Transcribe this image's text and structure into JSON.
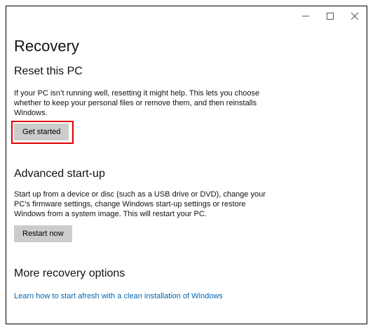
{
  "window": {
    "controls": [
      {
        "name": "minimize",
        "icon": "minimize-icon"
      },
      {
        "name": "maximize",
        "icon": "maximize-icon"
      },
      {
        "name": "close",
        "icon": "close-icon"
      }
    ]
  },
  "page": {
    "title": "Recovery"
  },
  "reset": {
    "heading": "Reset this PC",
    "description_lines": [
      "If your PC isn’t running well, resetting it might help. This lets you choose",
      "whether to keep your personal files or remove them, and then reinstalls",
      "Windows."
    ],
    "button_label": "Get started",
    "highlight_color": "#e00000"
  },
  "advanced": {
    "heading": "Advanced start-up",
    "description_lines": [
      "Start up from a device or disc (such as a USB drive or DVD), change your",
      "PC’s firmware settings, change Windows start-up settings or restore",
      "Windows from a system image. This will restart your PC."
    ],
    "button_label": "Restart now"
  },
  "more": {
    "heading": "More recovery options",
    "link_text": "Learn how to start afresh with a clean installation of Windows",
    "link_color": "#0066b4"
  }
}
